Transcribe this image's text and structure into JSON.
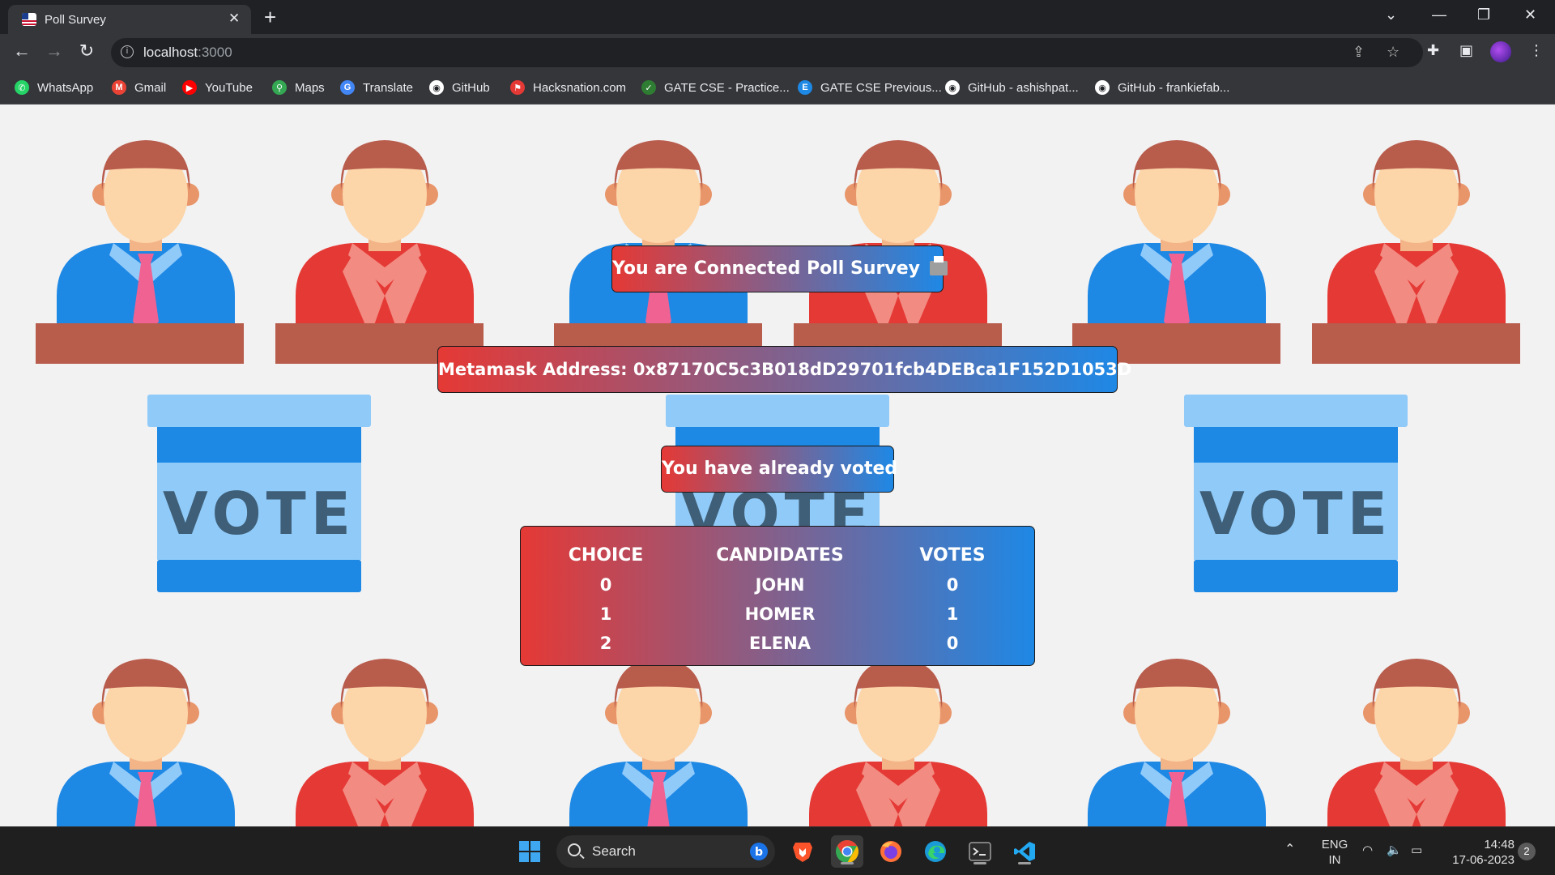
{
  "browser": {
    "tab_title": "Poll Survey",
    "url_host": "localhost",
    "url_port": ":3000",
    "bookmarks": [
      {
        "label": "WhatsApp",
        "color": "#25d366",
        "glyph": "✆"
      },
      {
        "label": "Gmail",
        "color": "#ea4335",
        "glyph": "M"
      },
      {
        "label": "YouTube",
        "color": "#ff0000",
        "glyph": "▶"
      },
      {
        "label": "Maps",
        "color": "#34a853",
        "glyph": "⚲"
      },
      {
        "label": "Translate",
        "color": "#4285f4",
        "glyph": "G"
      },
      {
        "label": "GitHub",
        "color": "#ffffff",
        "glyph": "◉"
      },
      {
        "label": "Hacksnation.com",
        "color": "#e53935",
        "glyph": "⚑"
      },
      {
        "label": "GATE CSE - Practice...",
        "color": "#2e7d32",
        "glyph": "✓"
      },
      {
        "label": "GATE CSE Previous...",
        "color": "#1e88e5",
        "glyph": "E"
      },
      {
        "label": "GitHub - ashishpat...",
        "color": "#ffffff",
        "glyph": "◉"
      },
      {
        "label": "GitHub - frankiefab...",
        "color": "#ffffff",
        "glyph": "◉"
      }
    ]
  },
  "page": {
    "connected_text": "You are Connected Poll Survey",
    "address_label": "Metamask Address:",
    "address_value": "0x87170C5c3B018dD29701fcb4DEBca1F152D1053D",
    "voted_text": "You have already voted",
    "background_box_word": "VOTE",
    "table_headers": [
      "CHOICE",
      "CANDIDATES",
      "VOTES"
    ],
    "table_rows": [
      {
        "choice": "0",
        "candidate": "JOHN",
        "votes": "0"
      },
      {
        "choice": "1",
        "candidate": "HOMER",
        "votes": "1"
      },
      {
        "choice": "2",
        "candidate": "ELENA",
        "votes": "0"
      }
    ],
    "colors": {
      "gradient_start": "#e53935",
      "gradient_end": "#1e88e5"
    }
  },
  "taskbar": {
    "search_placeholder": "Search",
    "lang_top": "ENG",
    "lang_bottom": "IN",
    "time": "14:48",
    "date": "17-06-2023",
    "notification_count": "2"
  }
}
